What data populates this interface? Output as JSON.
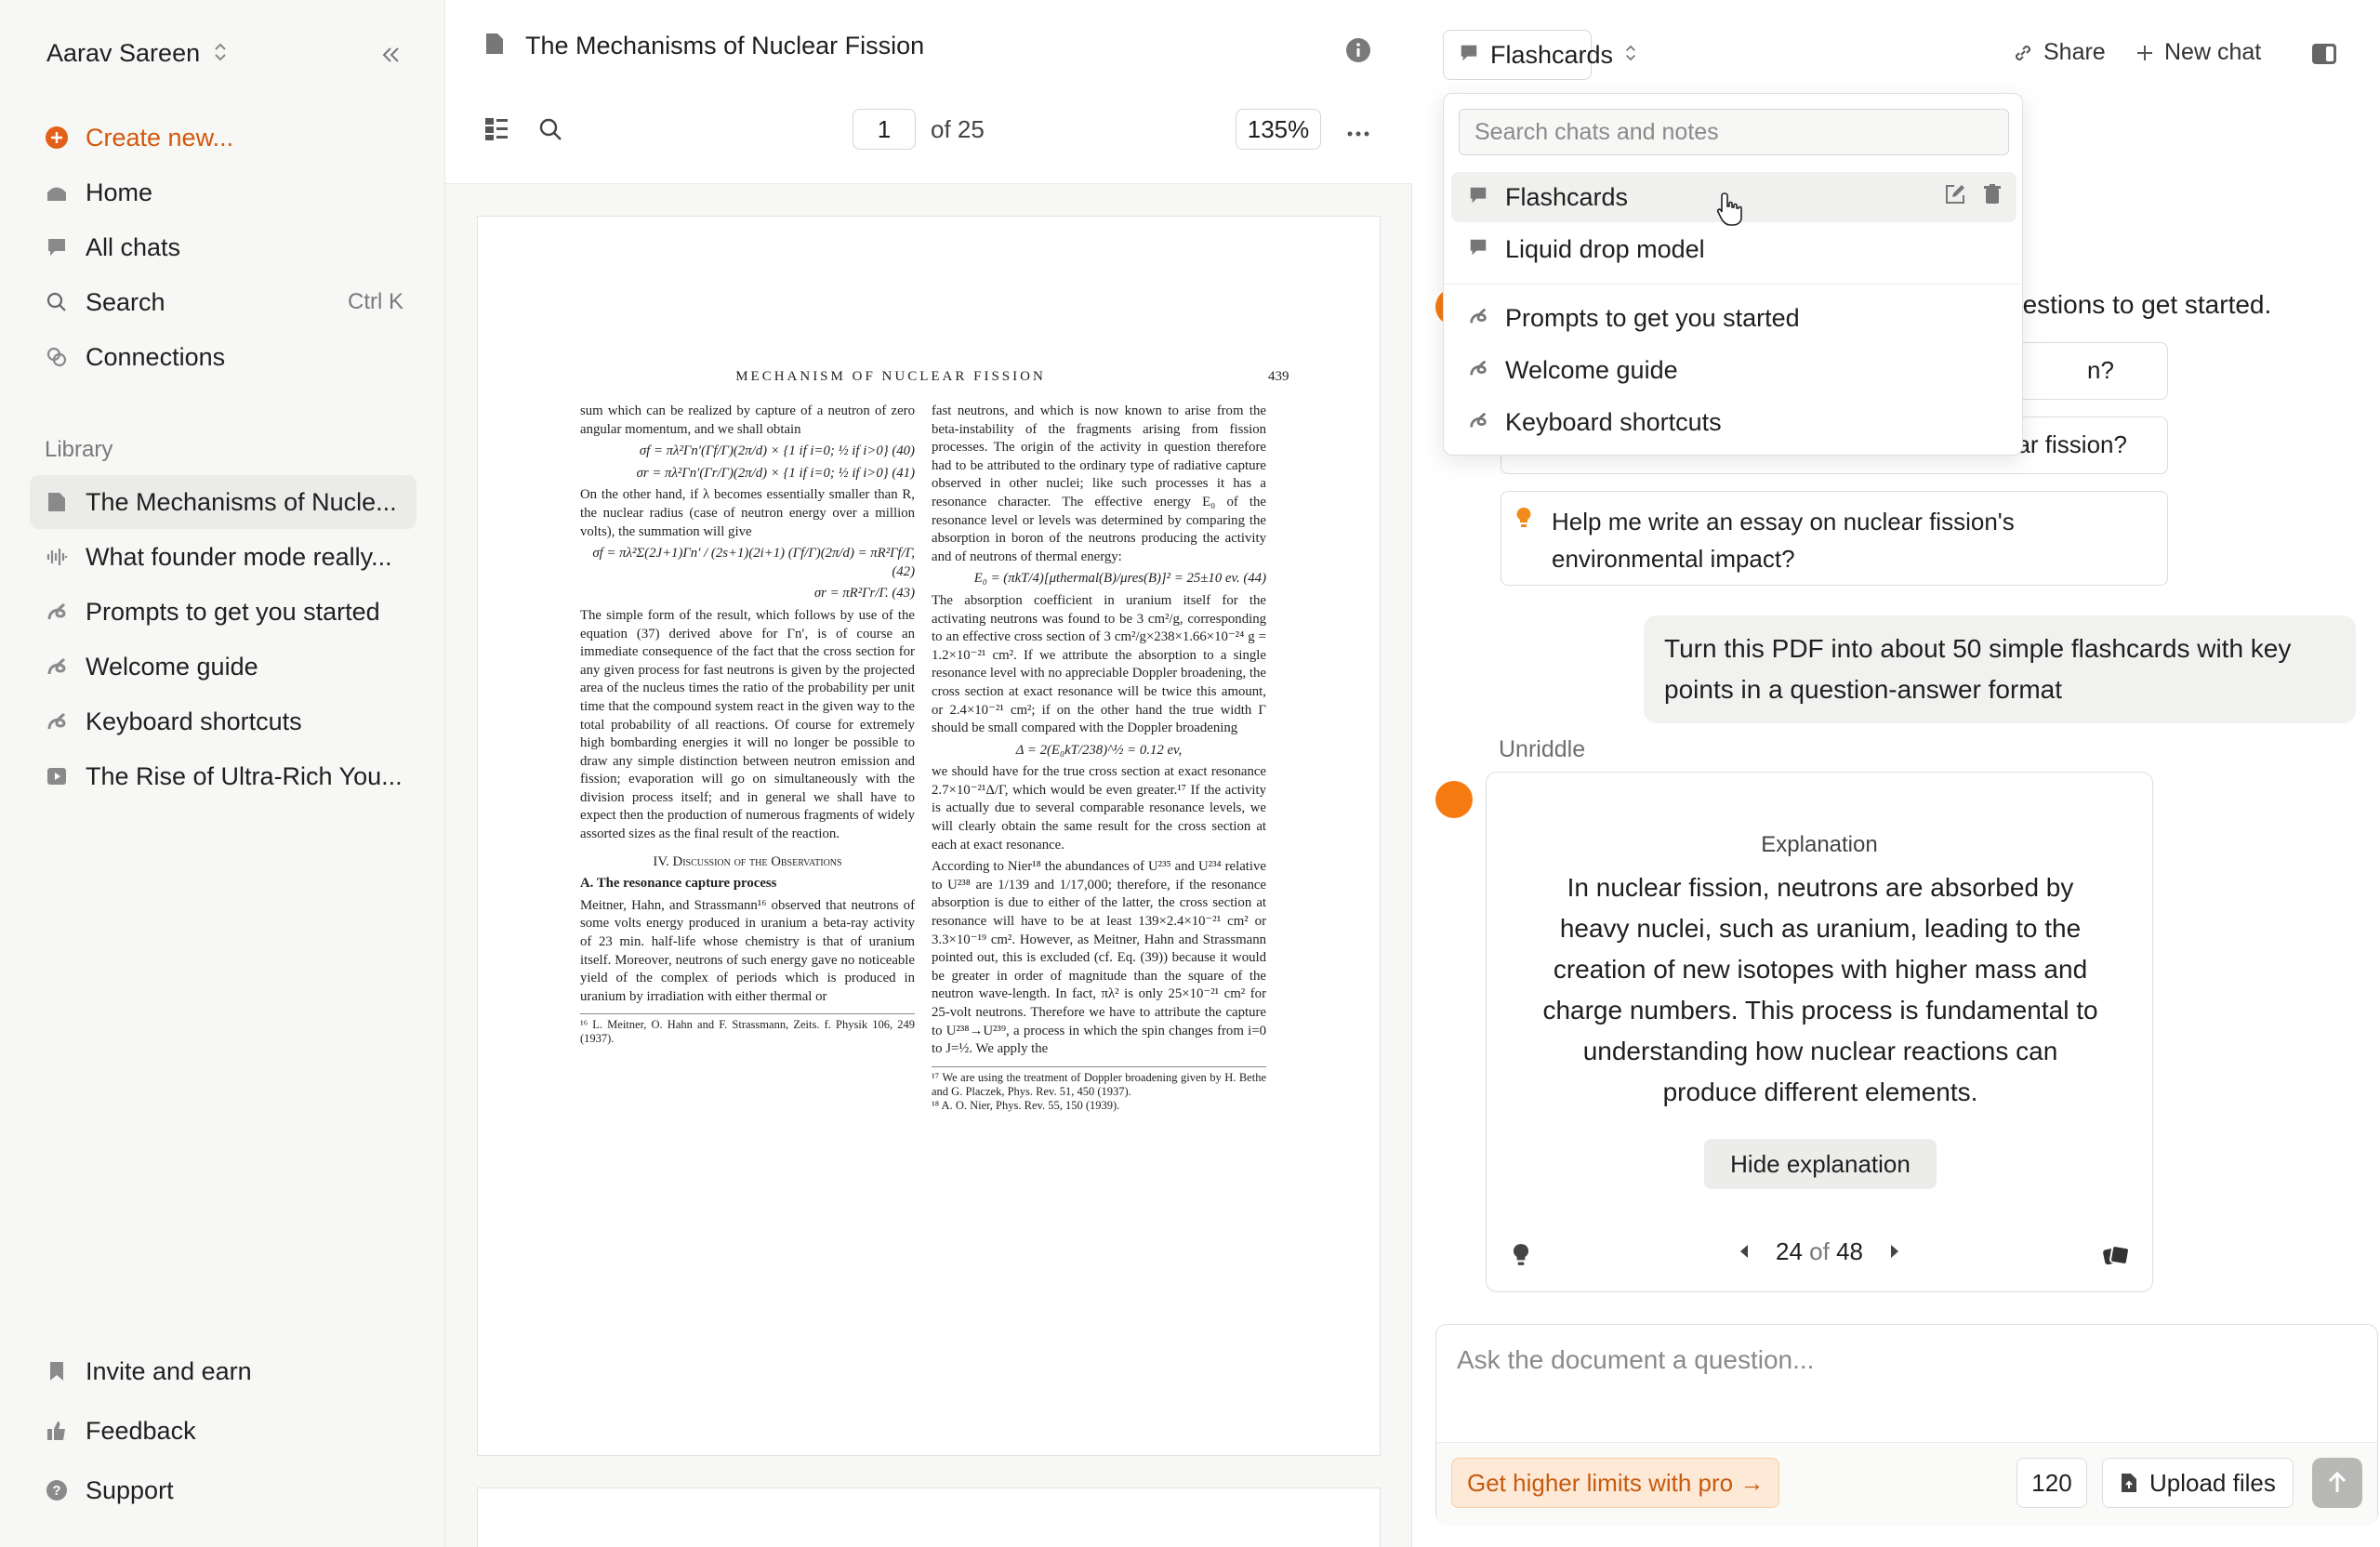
{
  "sidebar": {
    "user_name": "Aarav Sareen",
    "nav": {
      "create": "Create new...",
      "home": "Home",
      "all_chats": "All chats",
      "search": "Search",
      "search_shortcut": "Ctrl K",
      "connections": "Connections"
    },
    "library_label": "Library",
    "library": [
      "The Mechanisms of Nucle...",
      "What founder mode really...",
      "Prompts to get you started",
      "Welcome guide",
      "Keyboard shortcuts",
      "The Rise of Ultra-Rich You..."
    ],
    "bottom": {
      "invite": "Invite and earn",
      "feedback": "Feedback",
      "support": "Support"
    },
    "accent_color": "#d2580c"
  },
  "document": {
    "title": "The Mechanisms of Nuclear Fission",
    "page_current": "1",
    "page_total_label": "of 25",
    "zoom": "135%",
    "pdf": {
      "running_head": "MECHANISM OF NUCLEAR FISSION",
      "page_number": "439",
      "left_col": {
        "p1": "sum which can be realized by capture of a neutron of zero angular momentum, and we shall obtain",
        "eq40": "σf = πλ²Γn′(Γf/Γ)(2π/d) × {1 if i=0; ½ if i>0}   (40)",
        "eq41": "σr = πλ²Γn′(Γr/Γ)(2π/d) × {1 if i=0; ½ if i>0}   (41)",
        "p2": "On the other hand, if λ becomes essentially smaller than R, the nuclear radius (case of neutron energy over a million volts), the summation will give",
        "eq42": "σf = πλ²Σ(2J+1)Γn′ / (2s+1)(2i+1) (Γf/Γ)(2π/d) = πR²Γf/Γ,   (42)",
        "eq43": "σr = πR²Γr/Γ.   (43)",
        "p3": "The simple form of the result, which follows by use of the equation (37) derived above for Γn′, is of course an immediate consequence of the fact that the cross section for any given process for fast neutrons is given by the projected area of the nucleus times the ratio of the probability per unit time that the compound system react in the given way to the total probability of all reactions. Of course for extremely high bombarding energies it will no longer be possible to draw any simple distinction between neutron emission and fission; evaporation will go on simultaneously with the division process itself; and in general we shall have to expect then the production of numerous fragments of widely assorted sizes as the final result of the reaction.",
        "heading": "IV. Discussion of the Observations",
        "subheading": "A. The resonance capture process",
        "p4": "Meitner, Hahn, and Strassmann¹⁶ observed that neutrons of some volts energy produced in uranium a beta-ray activity of 23 min. half-life whose chemistry is that of uranium itself. Moreover, neutrons of such energy gave no noticeable yield of the complex of periods which is produced in uranium by irradiation with either thermal or",
        "fn": "¹⁶ L. Meitner, O. Hahn and F. Strassmann, Zeits. f. Physik 106, 249 (1937)."
      },
      "right_col": {
        "p1": "fast neutrons, and which is now known to arise from the beta-instability of the fragments arising from fission processes. The origin of the activity in question therefore had to be attributed to the ordinary type of radiative capture observed in other nuclei; like such processes it has a resonance character. The effective energy E₀ of the resonance level or levels was determined by comparing the absorption in boron of the neutrons producing the activity and of neutrons of thermal energy:",
        "eq44": "E₀ = (πkT/4)[μthermal(B)/μres(B)]² = 25±10 ev.   (44)",
        "p2": "The absorption coefficient in uranium itself for the activating neutrons was found to be 3 cm²/g, corresponding to an effective cross section of 3 cm²/g×238×1.66×10⁻²⁴ g = 1.2×10⁻²¹ cm². If we attribute the absorption to a single resonance level with no appreciable Doppler broadening, the cross section at exact resonance will be twice this amount, or 2.4×10⁻²¹ cm²; if on the other hand the true width Γ should be small compared with the Doppler broadening",
        "eq_doppler": "Δ = 2(E₀kT/238)^½ = 0.12 ev,",
        "p3": "we should have for the true cross section at exact resonance 2.7×10⁻²¹Δ/Γ, which would be even greater.¹⁷ If the activity is actually due to several comparable resonance levels, we will clearly obtain the same result for the cross section at each at exact resonance.",
        "p4": "According to Nier¹⁸ the abundances of U²³⁵ and U²³⁴ relative to U²³⁸ are 1/139 and 1/17,000; therefore, if the resonance absorption is due to either of the latter, the cross section at resonance will have to be at least 139×2.4×10⁻²¹ cm² or 3.3×10⁻¹⁹ cm². However, as Meitner, Hahn and Strassmann pointed out, this is excluded (cf. Eq. (39)) because it would be greater in order of magnitude than the square of the neutron wave-length. In fact, πλ² is only 25×10⁻²¹ cm² for 25-volt neutrons. Therefore we have to attribute the capture to U²³⁸→U²³⁹, a process in which the spin changes from i=0 to J=½. We apply the",
        "fn1": "¹⁷ We are using the treatment of Doppler broadening given by H. Bethe and G. Placzek, Phys. Rev. 51, 450 (1937).",
        "fn2": "¹⁸ A. O. Nier, Phys. Rev. 55, 150 (1939)."
      }
    }
  },
  "chat": {
    "selected_chat": "Flashcards",
    "share": "Share",
    "new_chat": "New chat",
    "suggest_intro_partial": "gestions to get started.",
    "suggestion_1_partial": "n?",
    "suggestion_2_partial": "ear fission?",
    "suggestion_3": "Help me write an essay on nuclear fission's environmental impact?",
    "user_message": "Turn this PDF into about 50 simple flashcards with key points in a question-answer format",
    "bot_name": "Unriddle",
    "flashcard": {
      "label": "Explanation",
      "text": "In nuclear fission, neutrons are absorbed by heavy nuclei, such as uranium, leading to the creation of new isotopes with higher mass and charge numbers. This process is fundamental to understanding how nuclear reactions can produce different elements.",
      "hide_button": "Hide explanation",
      "current": "24",
      "of": "of",
      "total": "48"
    },
    "input_placeholder": "Ask the document a question...",
    "pro_button": "Get higher limits with pro →",
    "char_count": "120",
    "upload": "Upload files",
    "avatar_color": "#f57a10"
  },
  "dropdown": {
    "search_placeholder": "Search chats and notes",
    "chats": [
      "Flashcards",
      "Liquid drop model"
    ],
    "notes": [
      "Prompts to get you started",
      "Welcome guide",
      "Keyboard shortcuts"
    ]
  }
}
